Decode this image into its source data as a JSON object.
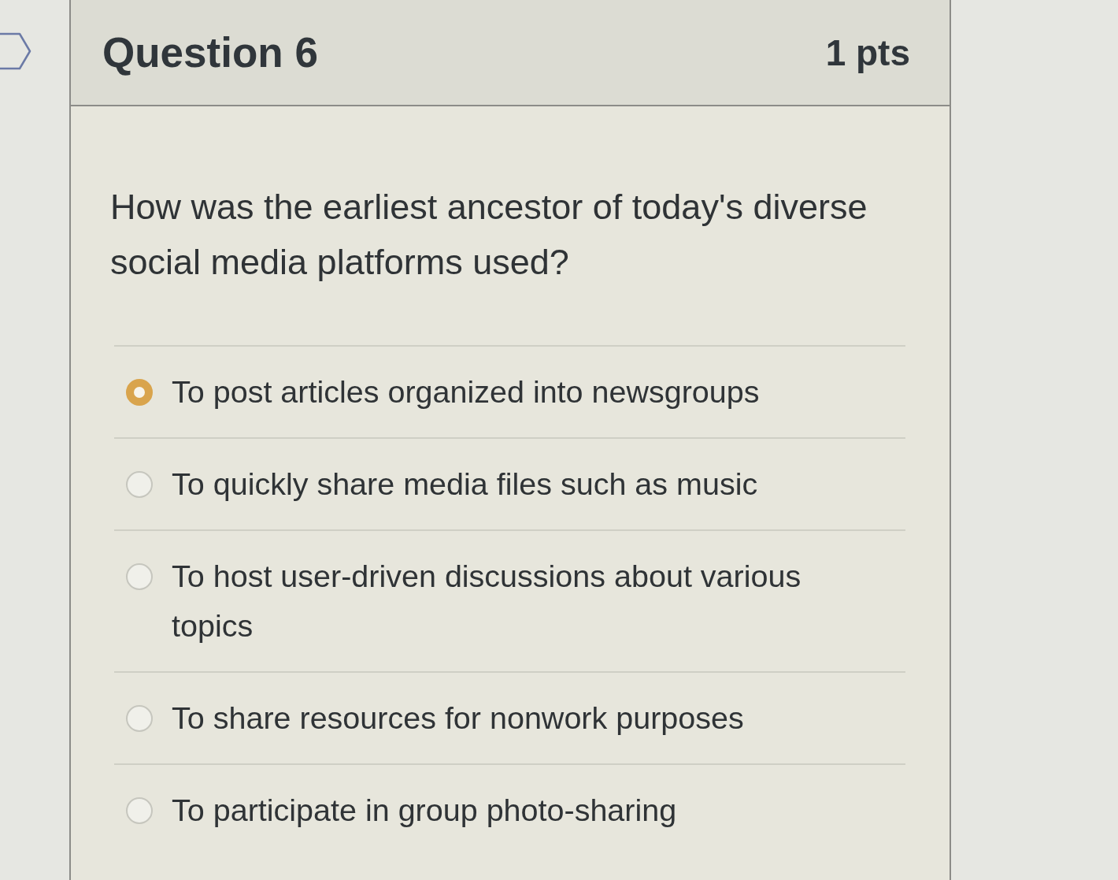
{
  "question": {
    "title": "Question 6",
    "points": "1 pts",
    "text": "How was the earliest ancestor of today's diverse social media platforms used?",
    "answers": [
      {
        "label": "To post articles organized into newsgroups",
        "selected": true
      },
      {
        "label": "To quickly share media files such as music",
        "selected": false
      },
      {
        "label": "To host user-driven discussions about various topics",
        "selected": false
      },
      {
        "label": "To share resources for nonwork purposes",
        "selected": false
      },
      {
        "label": "To participate in group photo-sharing",
        "selected": false
      }
    ]
  }
}
